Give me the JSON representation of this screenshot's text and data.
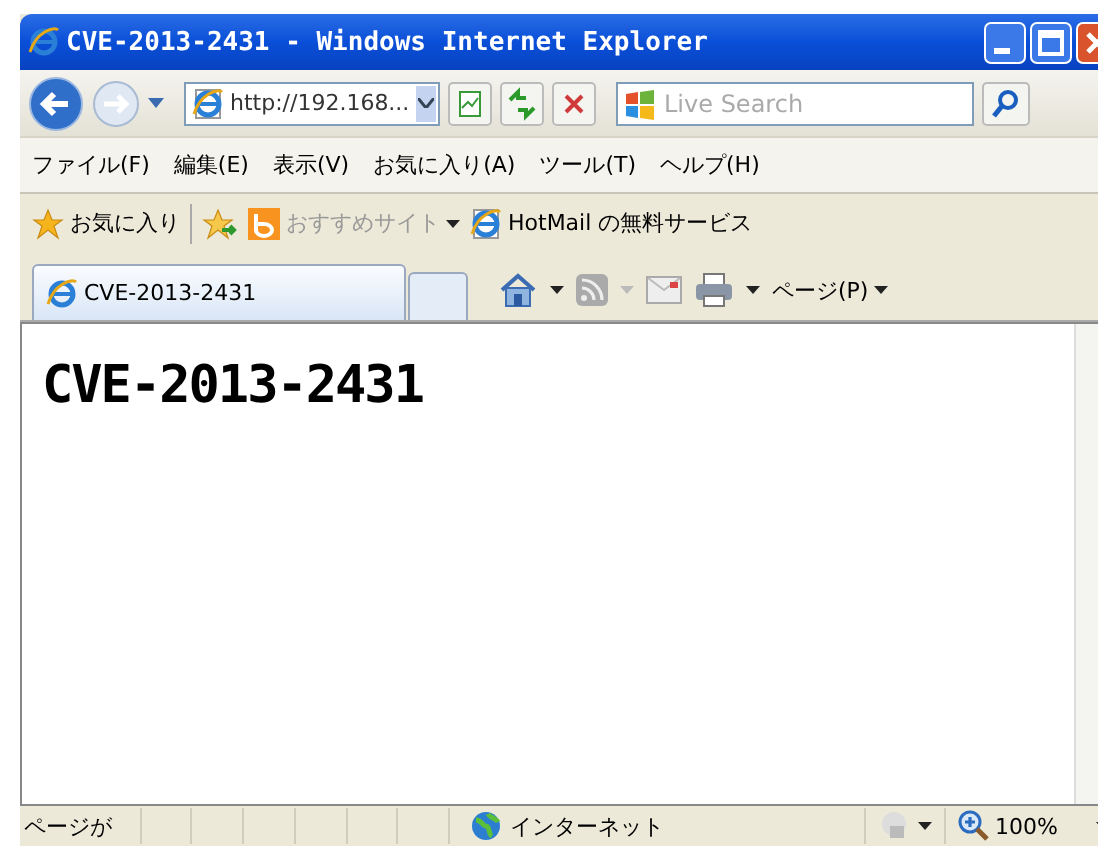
{
  "window": {
    "title": "CVE-2013-2431 - Windows Internet Explorer"
  },
  "address": {
    "value": "http://192.168..."
  },
  "search": {
    "placeholder": "Live Search"
  },
  "menu": [
    {
      "label": "ファイル(F)"
    },
    {
      "label": "編集(E)"
    },
    {
      "label": "表示(V)"
    },
    {
      "label": "お気に入り(A)"
    },
    {
      "label": "ツール(T)"
    },
    {
      "label": "ヘルプ(H)"
    }
  ],
  "favorites_bar": {
    "favorites": "お気に入り",
    "links": [
      {
        "label": "おすすめサイト",
        "kind": "menu"
      },
      {
        "label": "HotMail の無料サービス",
        "kind": "page"
      }
    ]
  },
  "tabs": [
    {
      "label": "CVE-2013-2431",
      "selected": true
    }
  ],
  "command_bar": {
    "page": "ページ(P)"
  },
  "content": {
    "heading": "CVE-2013-2431"
  },
  "status_bar": {
    "text": "ページが",
    "zone": "インターネット",
    "zoom": "100%"
  }
}
